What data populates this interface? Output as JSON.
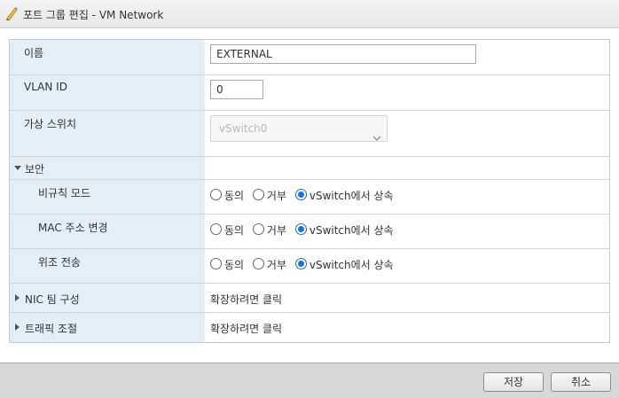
{
  "dialog": {
    "title": "포트 그룹 편집 - VM Network"
  },
  "fields": {
    "name": {
      "label": "이름",
      "value": "EXTERNAL"
    },
    "vlan": {
      "label": "VLAN ID",
      "value": "0"
    },
    "vswitch": {
      "label": "가상 스위치",
      "value": "vSwitch0",
      "disabled": true
    }
  },
  "security": {
    "label": "보안",
    "options": {
      "accept": "동의",
      "reject": "거부",
      "inherit": "vSwitch에서 상속"
    },
    "rows": [
      {
        "label": "비규칙 모드",
        "selected": "inherit"
      },
      {
        "label": "MAC 주소 변경",
        "selected": "inherit"
      },
      {
        "label": "위조 전송",
        "selected": "inherit"
      }
    ]
  },
  "nic_teaming": {
    "label": "NIC 팀 구성",
    "value": "확장하려면 클릭"
  },
  "traffic_shaping": {
    "label": "트래픽 조절",
    "value": "확장하려면 클릭"
  },
  "buttons": {
    "save": "저장",
    "cancel": "취소"
  },
  "colors": {
    "label_bg": "#e4eef6",
    "accent": "#1d6fd1",
    "footer_bg": "#d8d8d8"
  }
}
